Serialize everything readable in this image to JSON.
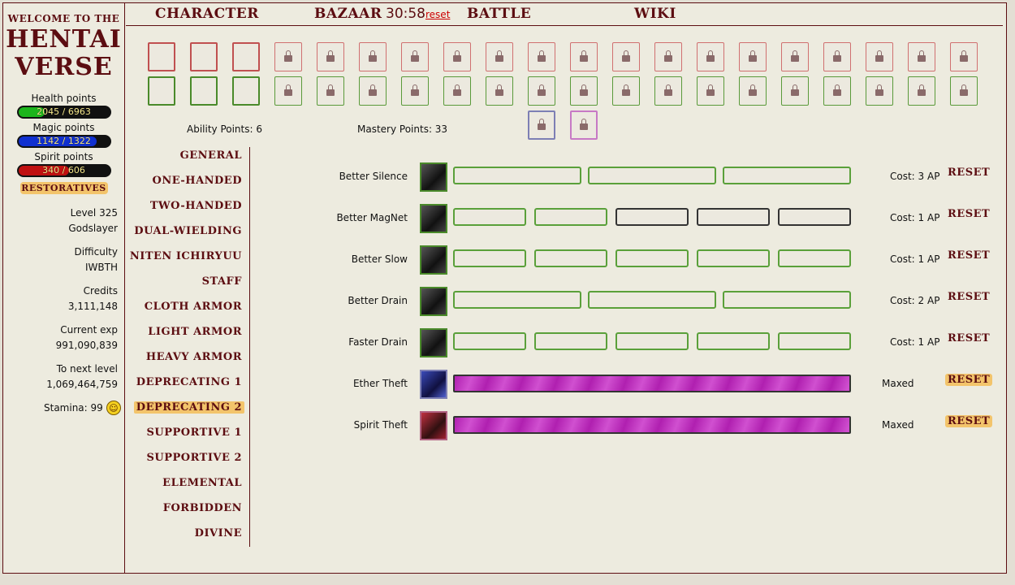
{
  "logo": {
    "welcome": "Welcome to the",
    "line1": "Hentai",
    "line2": "Verse"
  },
  "vitals": {
    "health": {
      "label": "Health points",
      "value": "2045 / 6963",
      "fraction": 0.294,
      "color": "#1cb51c"
    },
    "magic": {
      "label": "Magic points",
      "value": "1142 / 1322",
      "fraction": 0.864,
      "color": "#1030d0"
    },
    "spirit": {
      "label": "Spirit points",
      "value": "340 / 606",
      "fraction": 0.561,
      "color": "#c01010"
    }
  },
  "restoratives": "Restoratives",
  "stats": {
    "level": "Level 325",
    "title": "Godslayer",
    "difficulty_label": "Difficulty",
    "difficulty": "IWBTH",
    "credits_label": "Credits",
    "credits": "3,111,148",
    "exp_label": "Current exp",
    "exp": "991,090,839",
    "next_label": "To next level",
    "next": "1,069,464,759",
    "stamina": "Stamina: 99"
  },
  "nav": {
    "character": "Character",
    "bazaar": "Bazaar",
    "battle": "Battle",
    "wiki": "Wiki",
    "timer": "30:58",
    "reset": "reset"
  },
  "points": {
    "ability": "Ability Points: 6",
    "mastery": "Mastery Points: 33"
  },
  "categories": [
    "General",
    "One-handed",
    "Two-handed",
    "Dual-wielding",
    "Niten Ichiryuu",
    "Staff",
    "Cloth Armor",
    "Light Armor",
    "Heavy Armor",
    "Deprecating 1",
    "Deprecating 2",
    "Supportive 1",
    "Supportive 2",
    "Elemental",
    "Forbidden",
    "Divine"
  ],
  "active_category": 10,
  "abilities": [
    {
      "name": "Better Silence",
      "cost": "Cost: 3 AP",
      "reset": "Reset"
    },
    {
      "name": "Better MagNet",
      "cost": "Cost: 1 AP",
      "reset": "Reset"
    },
    {
      "name": "Better Slow",
      "cost": "Cost: 1 AP",
      "reset": "Reset"
    },
    {
      "name": "Better Drain",
      "cost": "Cost: 2 AP",
      "reset": "Reset"
    },
    {
      "name": "Faster Drain",
      "cost": "Cost: 1 AP",
      "reset": "Reset"
    },
    {
      "name": "Ether Theft",
      "status": "Maxed",
      "reset": "Reset"
    },
    {
      "name": "Spirit Theft",
      "status": "Maxed",
      "reset": "Reset"
    }
  ]
}
